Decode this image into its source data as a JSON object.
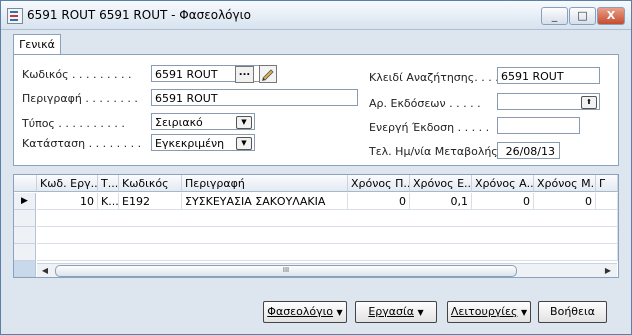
{
  "window": {
    "title": "6591 ROUT 6591 ROUT - Φασεολόγιο",
    "minimize": "_",
    "maximize": "□",
    "close": "X"
  },
  "tabs": [
    "Γενικά"
  ],
  "left_fields": [
    {
      "label": "Κωδικός . . . . . . . . .",
      "value": "6591 ROUT"
    },
    {
      "label": "Περιγραφή . . . . . . . .",
      "value": "6591 ROUT"
    },
    {
      "label": "Τύπος . . . . . . . . . .",
      "value": "Σειριακό"
    },
    {
      "label": "Κατάσταση . . . . . . . .",
      "value": "Εγκεκριμένη"
    }
  ],
  "right_fields": [
    {
      "label": "Κλειδί Αναζήτησης. . . .",
      "value": "6591 ROUT"
    },
    {
      "label": "Αρ. Εκδόσεων . . . . .",
      "value": ""
    },
    {
      "label": "Ενεργή Έκδοση . . . . .",
      "value": ""
    },
    {
      "label": "Τελ. Ημ/νία Μεταβολής . .",
      "value": "26/08/13"
    }
  ],
  "grid": {
    "headers": [
      "Κωδ. Εργ...",
      "Τ...",
      "Κωδικός",
      "Περιγραφή",
      "Χρόνος Π...",
      "Χρόνος Ε...",
      "Χρόνος Α...",
      "Χρόνος Μ...",
      "Γ"
    ],
    "rows": [
      [
        "10",
        "K...",
        "E192",
        "ΣΥΣΚΕΥΑΣΙΑ ΣΑΚΟΥΛΑΚΙΑ",
        "0",
        "0,1",
        "0",
        "0",
        ""
      ]
    ],
    "row_marker": "▶",
    "scroll_left": "◀",
    "scroll_right": "▶",
    "scroll_grip": "III"
  },
  "buttons": [
    "Φασεολόγιο",
    "Εργασία",
    "Λειτουργίες",
    "Βοήθεια"
  ],
  "icons": {
    "dropdown": "▼",
    "ellipsis": "...",
    "arrow_up": "⬆"
  }
}
